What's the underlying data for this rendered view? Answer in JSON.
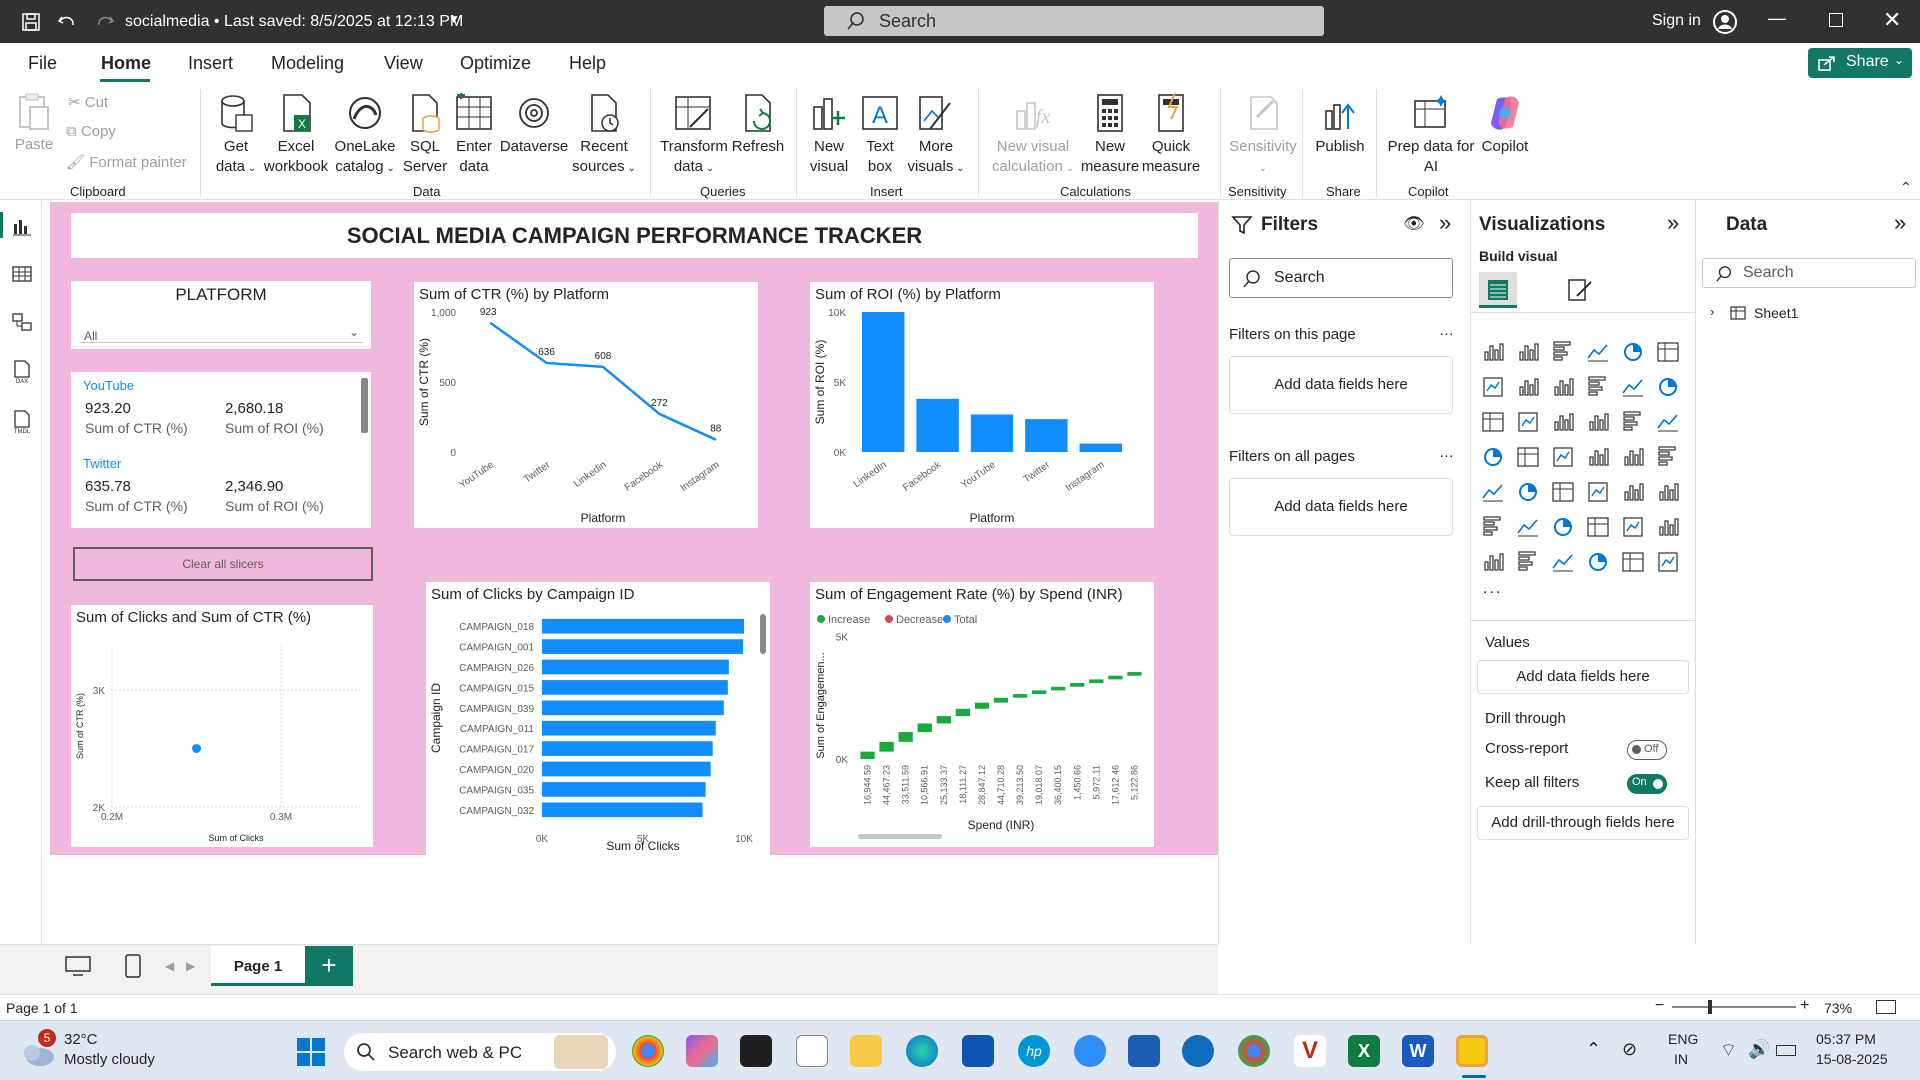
{
  "titlebar": {
    "doc_title": "socialmedia • Last saved: 8/5/2025 at 12:13 PM",
    "search": "Search",
    "signin": "Sign in"
  },
  "menu": {
    "file": "File",
    "home": "Home",
    "insert": "Insert",
    "modeling": "Modeling",
    "view": "View",
    "optimize": "Optimize",
    "help": "Help",
    "share": "Share"
  },
  "ribbon": {
    "paste": "Paste",
    "cut": "Cut",
    "copy": "Copy",
    "format_painter": "Format painter",
    "clipboard": "Clipboard",
    "get_data": [
      "Get",
      "data"
    ],
    "excel": [
      "Excel",
      "workbook"
    ],
    "onelake": [
      "OneLake",
      "catalog"
    ],
    "sql": [
      "SQL",
      "Server"
    ],
    "enter_data": [
      "Enter",
      "data"
    ],
    "dataverse": "Dataverse",
    "recent": [
      "Recent",
      "sources"
    ],
    "data_group": "Data",
    "transform": [
      "Transform",
      "data"
    ],
    "refresh": "Refresh",
    "queries": "Queries",
    "new_visual": [
      "New",
      "visual"
    ],
    "text_box": [
      "Text",
      "box"
    ],
    "more_visuals": [
      "More",
      "visuals"
    ],
    "insert_group": "Insert",
    "new_visual_calc": [
      "New visual",
      "calculation"
    ],
    "new_measure": [
      "New",
      "measure"
    ],
    "quick_measure": [
      "Quick",
      "measure"
    ],
    "calculations": "Calculations",
    "sensitivity": "Sensitivity",
    "sensitivity_group": "Sensitivity",
    "publish": "Publish",
    "share_group": "Share",
    "prep_data": [
      "Prep data for",
      "AI"
    ],
    "copilot": "Copilot",
    "copilot_group": "Copilot"
  },
  "report": {
    "title": "SOCIAL MEDIA CAMPAIGN  PERFORMANCE TRACKER",
    "slicer": {
      "title": "PLATFORM",
      "value": "All"
    },
    "card_rows": [
      {
        "platform": "YouTube",
        "ctr": "923.20",
        "roi": "2,680.18",
        "ctr_label": "Sum of CTR (%)",
        "roi_label": "Sum of ROI (%)"
      },
      {
        "platform": "Twitter",
        "ctr": "635.78",
        "roi": "2,346.90",
        "ctr_label": "Sum of CTR (%)",
        "roi_label": "Sum of ROI (%)"
      }
    ],
    "clear_slicers": "Clear all slicers"
  },
  "chart_data": [
    {
      "type": "line",
      "title": "Sum of CTR (%) by Platform",
      "xlabel": "Platform",
      "ylabel": "Sum of CTR (%)",
      "categories": [
        "YouTube",
        "Twitter",
        "Linkedin",
        "Facebook",
        "Instagram"
      ],
      "values": [
        923,
        636,
        608,
        272,
        88
      ],
      "data_labels": [
        "923",
        "636",
        "608",
        "272",
        "88"
      ],
      "yticks": [
        "1,000",
        "500",
        "0"
      ],
      "ylim": [
        0,
        1000
      ],
      "color": "#118dff"
    },
    {
      "type": "bar",
      "title": "Sum of ROI (%) by Platform",
      "xlabel": "Platform",
      "ylabel": "Sum of ROI (%)",
      "categories": [
        "LinkedIn",
        "Facebook",
        "YouTube",
        "Twitter",
        "Instagram"
      ],
      "values": [
        10000,
        3800,
        2680,
        2347,
        600
      ],
      "yticks": [
        "10K",
        "5K",
        "0K"
      ],
      "ylim": [
        0,
        10000
      ],
      "color": "#118dff"
    },
    {
      "type": "scatter",
      "title": "Sum of Clicks and Sum of CTR (%)",
      "xlabel": "Sum of Clicks",
      "ylabel": "Sum of CTR (%)",
      "points": [
        {
          "x": 0.25,
          "y": 2.5
        }
      ],
      "xticks": [
        "0.2M",
        "0.3M"
      ],
      "yticks": [
        "3K",
        "2K"
      ],
      "xlim": [
        0.2,
        0.3
      ],
      "ylim": [
        2,
        3
      ],
      "color": "#118dff"
    },
    {
      "type": "bar",
      "orientation": "horizontal",
      "title": "Sum of Clicks by Campaign ID",
      "xlabel": "Sum of Clicks",
      "ylabel": "Campaign ID",
      "categories": [
        "CAMPAIGN_018",
        "CAMPAIGN_001",
        "CAMPAIGN_026",
        "CAMPAIGN_015",
        "CAMPAIGN_039",
        "CAMPAIGN_011",
        "CAMPAIGN_017",
        "CAMPAIGN_020",
        "CAMPAIGN_035",
        "CAMPAIGN_032"
      ],
      "values": [
        10000,
        9950,
        9250,
        9200,
        9000,
        8600,
        8450,
        8350,
        8100,
        7950
      ],
      "xticks": [
        "0K",
        "5K",
        "10K"
      ],
      "xlim": [
        0,
        10000
      ],
      "color": "#118dff"
    },
    {
      "type": "bar",
      "subtype": "waterfall",
      "title": "Sum of Engagement Rate (%) by Spend (INR)",
      "xlabel": "Spend (INR)",
      "ylabel": "Sum of Engagemen...",
      "legend": [
        "Increase",
        "Decrease",
        "Total"
      ],
      "legend_colors": [
        "#1aab40",
        "#d64554",
        "#118dff"
      ],
      "categories": [
        "16,944.59",
        "44,467.23",
        "33,511.59",
        "10,566.91",
        "25,133.37",
        "18,111.27",
        "28,847.12",
        "44,710.28",
        "39,213.50",
        "19,018.07",
        "36,400.15",
        "1,450.66",
        "5,972.11",
        "17,612.46",
        "5,122.86"
      ],
      "cumulative": [
        300,
        700,
        1100,
        1450,
        1750,
        2050,
        2300,
        2500,
        2650,
        2800,
        2950,
        3100,
        3250,
        3400,
        3550
      ],
      "yticks": [
        "5K",
        "0K"
      ],
      "ylim": [
        0,
        6000
      ],
      "color": "#1aab40"
    }
  ],
  "filters": {
    "title": "Filters",
    "search": "Search",
    "on_page": "Filters on this page",
    "on_all": "Filters on all pages",
    "add": "Add data fields here"
  },
  "viz": {
    "title": "Visualizations",
    "build": "Build visual",
    "values": "Values",
    "add": "Add data fields here",
    "drill": "Drill through",
    "cross": "Cross-report",
    "cross_state": "Off",
    "keep": "Keep all filters",
    "keep_state": "On",
    "add_drill": "Add drill-through fields here",
    "more": "..."
  },
  "data": {
    "title": "Data",
    "search": "Search",
    "table": "Sheet1"
  },
  "pages": {
    "tab": "Page 1",
    "add": "+",
    "status": "Page 1 of 1",
    "zoom": "73%"
  },
  "taskbar": {
    "temp": "32°C",
    "weather": "Mostly cloudy",
    "badge": "5",
    "search": "Search web & PC",
    "lang1": "ENG",
    "lang2": "IN",
    "time": "05:37 PM",
    "date": "15-08-2025"
  }
}
